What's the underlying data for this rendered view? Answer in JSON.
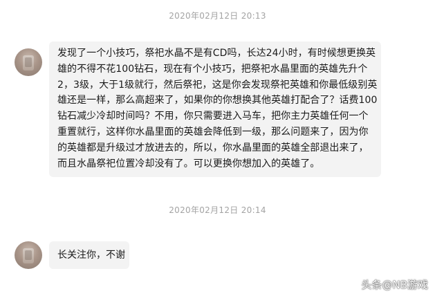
{
  "chat": {
    "messages": [
      {
        "timestamp": "2020年02月12日 20:13",
        "avatar_icon": "user-avatar-blurred",
        "lines": [
          "发现了一个小技巧，祭祀水晶不是有CD吗，长达24小时，有时候想更换英",
          "雄的不得不花100钻石，现在有个小技巧，把祭祀水晶里面的英雄先升个",
          "2，3级，大于1级就行，然后祭祀，这是你会发现祭祀英雄和你最低级别英",
          "雄还是一样，那么高超来了，如果你的你想换其他英雄打配合了？话费100",
          "钻石减少冷却时间吗？不用，你只需要进入马车，把你主力英雄任何一个",
          "重置就行，这样你水晶里面的英雄会降低到一级，那么问题来了，因为你",
          "的英雄都是升级过才放进去的，所以，你水晶里面的英雄全部退出来了，",
          "而且水晶祭祀位置冷却没有了。可以更换你想加入的英雄了。"
        ]
      },
      {
        "timestamp": "2020年02月12日 20:14",
        "avatar_icon": "user-avatar-blurred",
        "text": "长关注你，不谢"
      }
    ]
  },
  "watermark": {
    "text": "头条@NB游戏"
  },
  "colors": {
    "bubble_bg": "#f3f3f3",
    "timestamp": "#a3a3a3",
    "text": "#1a1a1a"
  }
}
